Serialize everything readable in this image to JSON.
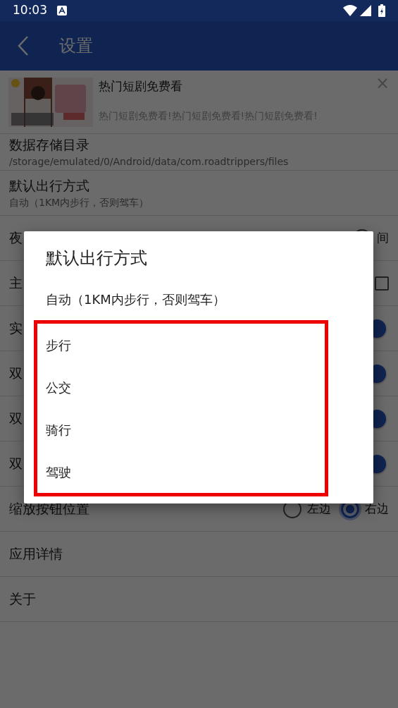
{
  "status_bar": {
    "time": "10:03"
  },
  "app_bar": {
    "title": "设置"
  },
  "ad": {
    "kind": "picture",
    "title": "热门短剧免费看",
    "description": "热门短剧免费看!热门短剧免费看!热门短剧免费看!",
    "close": "×"
  },
  "settings": [
    {
      "kind": "text",
      "label": "数据存储目录",
      "value": "/storage/emulated/0/Android/data/com.roadtrippers/files"
    },
    {
      "kind": "text",
      "label": "默认出行方式",
      "value": "自动（1KM内步行，否则驾车）"
    },
    {
      "kind": "radios",
      "label": "夜",
      "options": [
        {
          "label": "间",
          "selected": false
        }
      ]
    },
    {
      "kind": "checkbox",
      "label": "主",
      "checked": false
    },
    {
      "kind": "switch",
      "label": "实",
      "on": true
    },
    {
      "kind": "switch",
      "label": "双",
      "on": true
    },
    {
      "kind": "switch",
      "label": "双",
      "on": true
    },
    {
      "kind": "switch",
      "label": "双",
      "on": true
    },
    {
      "kind": "radios",
      "label": "缩放按钮位置",
      "options": [
        {
          "label": "左边",
          "selected": false
        },
        {
          "label": "右边",
          "selected": true
        }
      ]
    },
    {
      "kind": "plain",
      "label": "应用详情"
    },
    {
      "kind": "plain",
      "label": "关于"
    }
  ],
  "dialog": {
    "title": "默认出行方式",
    "options": [
      {
        "label": "自动（1KM内步行，否则驾车）",
        "highlighted": false
      },
      {
        "label": "步行",
        "highlighted": true
      },
      {
        "label": "公交",
        "highlighted": true
      },
      {
        "label": "骑行",
        "highlighted": true
      },
      {
        "label": "驾驶",
        "highlighted": true
      }
    ]
  }
}
